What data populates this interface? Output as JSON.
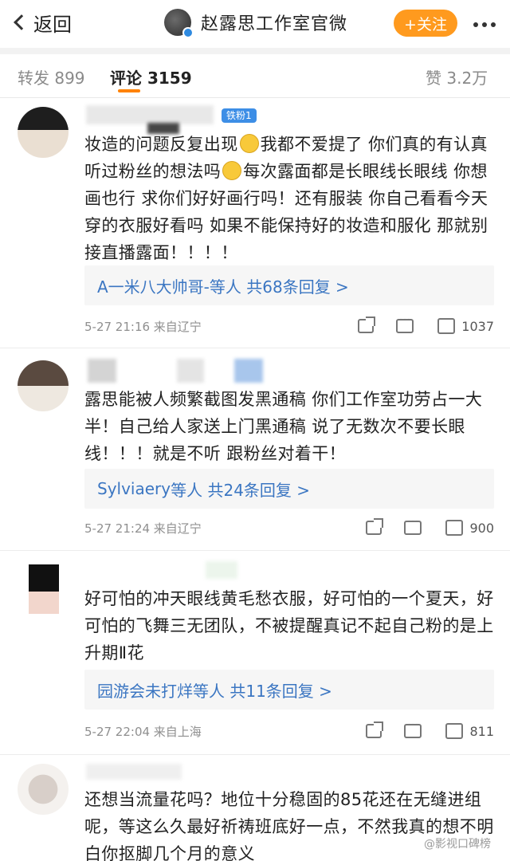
{
  "header": {
    "back_label": "返回",
    "title": "赵露思工作室官微",
    "follow_label": "+关注"
  },
  "tabs": {
    "repost": "转发 899",
    "comment": "评论 3159",
    "like": "赞 3.2万"
  },
  "comments": [
    {
      "badge": "铁粉1",
      "text_parts": [
        "妆造的问题反复出现",
        "我都不爱提了 你们真的有认真听过粉丝的想法吗",
        "每次露面都是长眼线长眼线 你想画也行 求你们好好画行吗！还有服装 你自己看看今天穿的衣服好看吗 如果不能保持好的妆造和服化 那就别接直播露面！！！！"
      ],
      "reply": "A一米八大帅哥-等人 共68条回复 >",
      "time": "5-27 21:16 来自辽宁",
      "likes": "1037"
    },
    {
      "text": "露思能被人频繁截图发黑通稿 你们工作室功劳占一大半！自己给人家送上门黑通稿 说了无数次不要长眼线！！！就是不听 跟粉丝对着干！",
      "reply_name": "Sylviaery",
      "reply_rest": "等人 共24条回复 >",
      "time": "5-27 21:24 来自辽宁",
      "likes": "900"
    },
    {
      "text": "好可怕的冲天眼线黄毛愁衣服，好可怕的一个夏天，好可怕的飞舞三无团队，不被提醒真记不起自己粉的是上升期Ⅱ花",
      "reply_name": "园游会未打烊",
      "reply_rest": "等人 共11条回复 >",
      "time": "5-27 22:04 来自上海",
      "likes": "811"
    },
    {
      "text": "还想当流量花吗？地位十分稳固的85花还在无缝进组呢，等这么久最好祈祷班底好一点，不然我真的想不明白你抠脚几个月的意义"
    }
  ],
  "watermark": "@影视口碑榜"
}
